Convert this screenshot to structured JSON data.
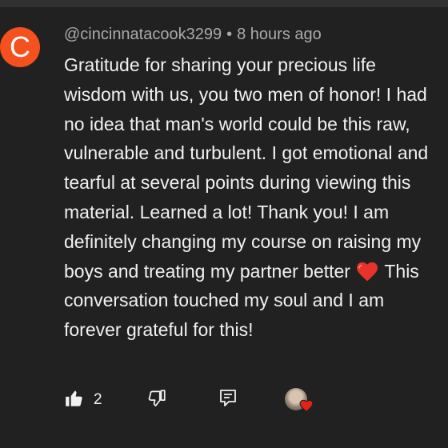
{
  "comment": {
    "author_initial": "C",
    "author_handle": "@cincinnatacook3299",
    "separator": "•",
    "timestamp": "8 hours ago",
    "text_before_emoji": "Gratitude for sharing your precious life wisdom with us, you two men of honor! I had no idea that man's world could be this raw, vulnerable and turbulent. I got emotional and tearful at several points during viewing this material. Learned a lot! Thank you! I am definitely  changing my course on raising my boys and treating my partner better ",
    "emoji_icon": "heart-icon",
    "text_after_emoji": " This conversation touched my soul and I am forever grateful for this!",
    "avatar_color": "#f4511e"
  },
  "actions": {
    "like_icon": "thumbs-up-icon",
    "like_count": "2",
    "dislike_icon": "thumbs-down-icon",
    "reply_icon": "reply-comment-icon",
    "creator_heart_icon": "creator-heart-icon",
    "heart_color": "#e62117"
  }
}
